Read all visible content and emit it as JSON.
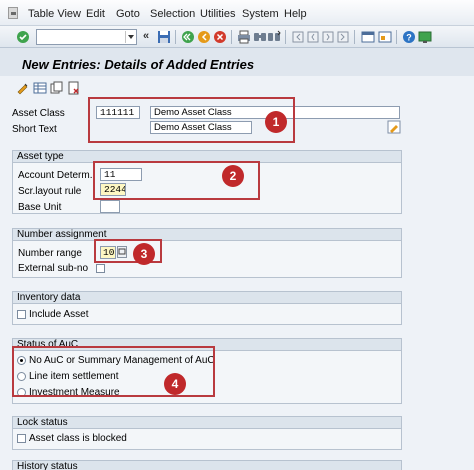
{
  "menubar": {
    "items": [
      "Table View",
      "Edit",
      "Goto",
      "Selection",
      "Utilities",
      "System",
      "Help"
    ]
  },
  "toolbar": {
    "command_field_value": "",
    "icons": [
      "enter-icon",
      "save-icon",
      "back-icon",
      "exit-icon",
      "cancel-icon",
      "print-icon",
      "find-icon",
      "find-next-icon",
      "first-page-icon",
      "previous-page-icon",
      "next-page-icon",
      "last-page-icon",
      "new-session-icon",
      "shortcut-icon",
      "help-icon",
      "layout-icon"
    ]
  },
  "page": {
    "title": "New Entries: Details of Added Entries"
  },
  "app_toolbar": {
    "icons": [
      "display-change-icon",
      "table-icon",
      "copy-icon",
      "delete-icon"
    ]
  },
  "header": {
    "asset_class_label": "Asset Class",
    "asset_class_value": "111111",
    "asset_class_desc": "Demo Asset Class",
    "short_text_label": "Short Text",
    "short_text_value": "Demo Asset Class"
  },
  "asset_type": {
    "title": "Asset type",
    "account_determ_label": "Account Determ.",
    "account_determ_value": "11",
    "scr_layout_label": "Scr.layout rule",
    "scr_layout_value": "2244",
    "base_unit_label": "Base Unit",
    "base_unit_value": ""
  },
  "number_assignment": {
    "title": "Number assignment",
    "number_range_label": "Number range",
    "number_range_value": "10",
    "external_sub_label": "External sub-no"
  },
  "inventory": {
    "title": "Inventory data",
    "include_asset_label": "Include Asset"
  },
  "auc": {
    "title": "Status of AuC",
    "options": [
      "No AuC or Summary Management of AuC",
      "Line item settlement",
      "Investment Measure"
    ],
    "selected_index": 0
  },
  "lock": {
    "title": "Lock status",
    "blocked_label": "Asset class is blocked"
  },
  "history": {
    "title": "History status"
  },
  "annotations": [
    "1",
    "2",
    "3",
    "4"
  ],
  "colors": {
    "annotation_red": "#c0292b",
    "panel_header": "#dce4ec",
    "field_highlight": "#fdf7c3"
  }
}
